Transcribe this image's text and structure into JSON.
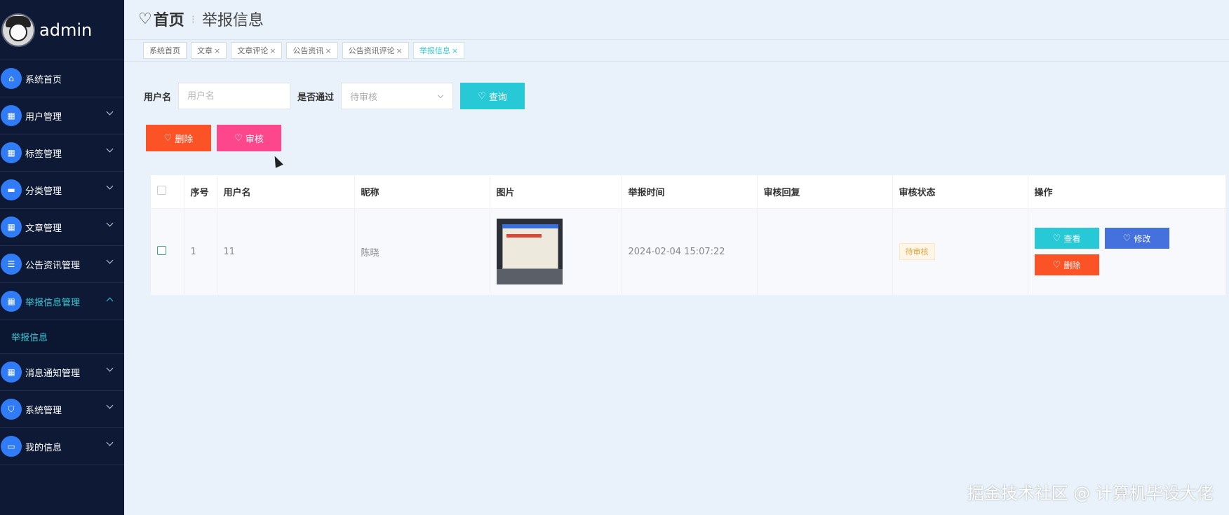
{
  "sidebar": {
    "username": "admin",
    "items": [
      {
        "label": "系统首页",
        "icon": "home-icon",
        "expandable": false
      },
      {
        "label": "用户管理",
        "icon": "grid-icon",
        "expandable": true
      },
      {
        "label": "标签管理",
        "icon": "grid-icon",
        "expandable": true
      },
      {
        "label": "分类管理",
        "icon": "chat-icon",
        "expandable": true
      },
      {
        "label": "文章管理",
        "icon": "grid-icon",
        "expandable": true
      },
      {
        "label": "公告资讯管理",
        "icon": "list-icon",
        "expandable": true
      },
      {
        "label": "举报信息管理",
        "icon": "grid-icon",
        "expandable": true,
        "active": true
      },
      {
        "label": "消息通知管理",
        "icon": "grid-icon",
        "expandable": true
      },
      {
        "label": "系统管理",
        "icon": "shield-icon",
        "expandable": true
      },
      {
        "label": "我的信息",
        "icon": "card-icon",
        "expandable": true
      }
    ],
    "submenu_active": "举报信息"
  },
  "header": {
    "home_label": "首页",
    "current_label": "举报信息"
  },
  "tabs": [
    {
      "label": "系统首页",
      "closable": false
    },
    {
      "label": "文章",
      "closable": true
    },
    {
      "label": "文章评论",
      "closable": true
    },
    {
      "label": "公告资讯",
      "closable": true
    },
    {
      "label": "公告资讯评论",
      "closable": true
    },
    {
      "label": "举报信息",
      "closable": true,
      "active": true
    }
  ],
  "tab_close_glyph": "×",
  "search": {
    "username_label": "用户名",
    "username_placeholder": "用户名",
    "passed_label": "是否通过",
    "passed_value": "待审核",
    "query_button": "查询"
  },
  "actions": {
    "delete_button": "删除",
    "audit_button": "审核"
  },
  "table": {
    "columns": [
      "序号",
      "用户名",
      "昵称",
      "图片",
      "举报时间",
      "审核回复",
      "审核状态",
      "操作"
    ],
    "rows": [
      {
        "index": "1",
        "username": "11",
        "nickname": "陈晓",
        "report_time": "2024-02-04 15:07:22",
        "audit_reply": "",
        "audit_status": "待审核",
        "ops": {
          "view": "查看",
          "edit": "修改",
          "delete": "删除"
        }
      }
    ]
  },
  "watermark": "掘金技术社区 @ 计算机毕设大佬",
  "colors": {
    "sidebar_bg": "#0e1a35",
    "accent_cyan": "#26c9d5",
    "danger": "#fb5226",
    "pink": "#fd478d",
    "blue": "#4471de",
    "page_bg": "#e9f2fa"
  }
}
